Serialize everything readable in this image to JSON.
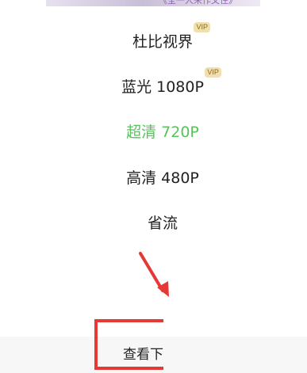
{
  "banner": {
    "caption": "《全一人来作文住》"
  },
  "quality_options": [
    {
      "label": "杜比视界",
      "badge": "VIP",
      "selected": false
    },
    {
      "label": "蓝光 1080P",
      "badge": "VIP",
      "selected": false
    },
    {
      "label": "超清 720P",
      "badge": "",
      "selected": true
    },
    {
      "label": "高清 480P",
      "badge": "",
      "selected": false
    },
    {
      "label": "省流",
      "badge": "",
      "selected": false
    }
  ],
  "download": {
    "label": "查看下载"
  },
  "colors": {
    "selected": "#57c35a",
    "highlight": "#e53935",
    "vip_badge_bg": "#f1dfae",
    "vip_badge_text": "#8a6a1d"
  }
}
